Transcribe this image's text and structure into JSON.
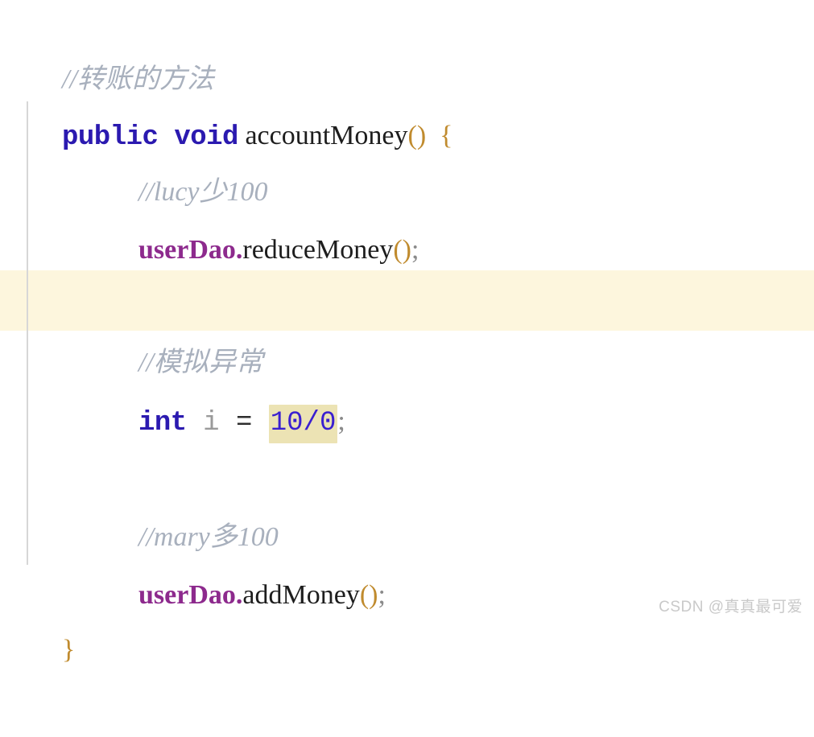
{
  "editor": {
    "background_color": "#ffffff",
    "caret_line_highlight_color": "#fdf6dd",
    "inline_match_highlight_color": "#ece3b4",
    "indent_guide_color": "#d7d7d7",
    "colors": {
      "comment": "#a8b0bd",
      "keyword": "#2b1ab0",
      "field": "#8d2a8d",
      "method": "#1d1d1d",
      "brace": "#c08b2e",
      "number": "#3a1fd0",
      "local_variable": "#9a9a9a",
      "semicolon": "#8a8a8a"
    }
  },
  "code": {
    "line1": {
      "comment": "//转账的方法"
    },
    "line2": {
      "keyword_public": "public",
      "space1": " ",
      "keyword_void": "void",
      "space2": " ",
      "method_name": "accountMoney",
      "parens": "()",
      "space3": "  ",
      "open_brace": "{"
    },
    "line3": {
      "comment": "//lucy少100"
    },
    "line4": {
      "field": "userDao",
      "dot": ".",
      "method_name": "reduceMoney",
      "parens": "()",
      "semicolon": ";"
    },
    "line5": {
      "comment": "//模拟异常"
    },
    "line6": {
      "keyword_int": "int",
      "space1": " ",
      "variable": "i",
      "space2": " ",
      "operator": "=",
      "space3": " ",
      "expression": "10/0",
      "semicolon": ";"
    },
    "line7": {
      "comment": "//mary多100"
    },
    "line8": {
      "field": "userDao",
      "dot": ".",
      "method_name": "addMoney",
      "parens": "()",
      "semicolon": ";"
    },
    "line9": {
      "close_brace": "}"
    }
  },
  "watermark": {
    "text": "CSDN @真真最可爱"
  }
}
